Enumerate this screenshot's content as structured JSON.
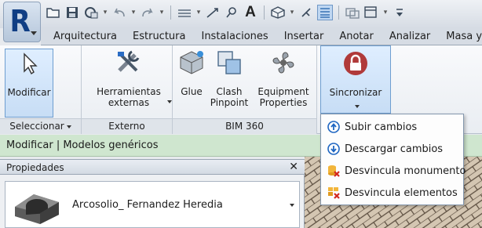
{
  "quick_access": {
    "icons": [
      "open-icon",
      "save-icon",
      "sync-icon",
      "undo-icon",
      "redo-icon",
      "measure-icon",
      "dimension-icon",
      "tag-icon",
      "text-icon",
      "3d-view-icon",
      "section-icon",
      "thin-lines-icon",
      "close-windows-icon",
      "switch-windows-icon",
      "customize-icon"
    ],
    "text_tool_label": "A"
  },
  "app_button": {
    "letter": "R"
  },
  "tabs": [
    "Arquitectura",
    "Estructura",
    "Instalaciones",
    "Insertar",
    "Anotar",
    "Analizar",
    "Masa y"
  ],
  "ribbon": {
    "modify_label": "Modificar",
    "external_tools_label": "Herramientas externas",
    "glue_label": "Glue",
    "clash_label": "Clash Pinpoint",
    "equipment_label": "Equipment Properties",
    "sync_label": "Sincronizar",
    "footer_select": "Seleccionar",
    "footer_external": "Externo",
    "footer_bim360": "BIM 360"
  },
  "context_bar": {
    "text": "Modificar | Modelos genéricos"
  },
  "properties": {
    "title": "Propiedades",
    "close": "✕",
    "type_name": "Arcosolio_ Fernandez Heredia"
  },
  "sync_menu": {
    "items": [
      {
        "label": "Subir cambios",
        "icon": "upload-circle-icon"
      },
      {
        "label": "Descargar cambios",
        "icon": "download-circle-icon"
      },
      {
        "label": "Desvincula monumento",
        "icon": "unlink-database-icon"
      },
      {
        "label": "Desvincula elementos",
        "icon": "unlink-elements-icon"
      }
    ]
  },
  "colors": {
    "accent": "#103e84",
    "context_bar": "#cfe6cf",
    "sync_icon": "#b03a3a"
  }
}
